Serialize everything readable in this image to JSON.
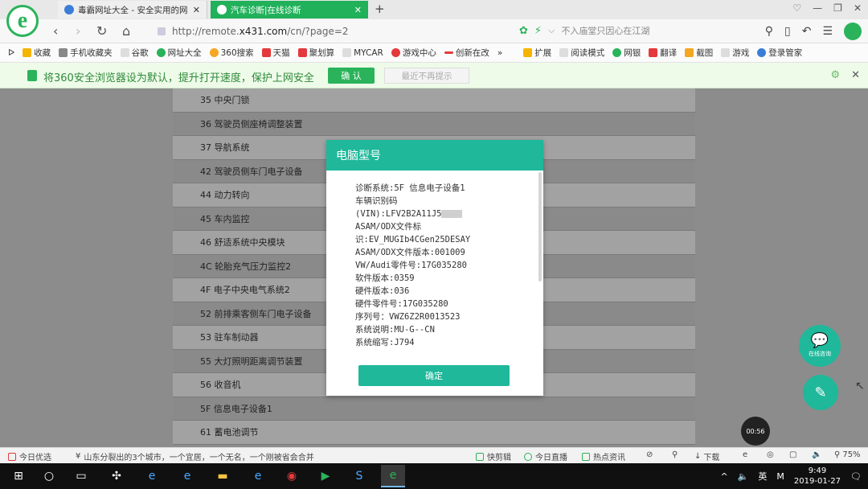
{
  "browser": {
    "tabs": [
      {
        "label": "毒霸网址大全 - 安全实用的网址"
      },
      {
        "label": "汽车诊断|在线诊断"
      }
    ],
    "url_prefix": "http://remote.",
    "url_host": "x431.com",
    "url_path": "/cn/?page=2",
    "search_hint": "不入庙堂只因心在江湖",
    "bookmarks": [
      "收藏",
      "手机收藏夹",
      "谷歌",
      "网址大全",
      "360搜索",
      "天猫",
      "聚划算",
      "MYCAR",
      "游戏中心",
      "创新在改",
      "扩展",
      "阅读模式",
      "网银",
      "翻译",
      "截图",
      "游戏",
      "登录管家"
    ]
  },
  "notification": {
    "message": "将360安全浏览器设为默认，提升打开速度，保护上网安全",
    "confirm": "确 认",
    "dismiss": "最近不再提示"
  },
  "list": [
    "35 中央门锁",
    "36 驾驶员侧座椅调整装置",
    "37 导航系统",
    "42 驾驶员侧车门电子设备",
    "44 动力转向",
    "45 车内监控",
    "46 舒适系统中央模块",
    "4C 轮胎充气压力监控2",
    "4F 电子中央电气系统2",
    "52 前排乘客侧车门电子设备",
    "53 驻车制动器",
    "55 大灯照明距离调节装置",
    "56 收音机",
    "5F 信息电子设备1",
    "61 蓄电池调节"
  ],
  "modal": {
    "title": "电脑型号",
    "lines": [
      "诊断系统:5F 信息电子设备1",
      "车辆识别码",
      "(VIN):LFV2B2A11J5",
      "ASAM/ODX文件标",
      "识:EV_MUGIb4CGen25DESAY",
      "ASAM/ODX文件版本:001009",
      "VW/Audi零件号:17G035280",
      "软件版本:0359",
      "硬件版本:036",
      "硬件零件号:17G035280",
      "序列号：VWZ6Z2R0013523",
      "系统说明:MU-G--CN",
      "系统缩写:J794"
    ],
    "ok": "确定"
  },
  "fab": {
    "chat_label": "在线咨询"
  },
  "timer": "00:56",
  "statusbar": {
    "left": "今日优选",
    "news": "山东分裂出的3个城市，一个宜居，一个无名，一个刚被省会合并",
    "items": [
      "快剪辑",
      "今日直播",
      "热点资讯",
      "下载"
    ],
    "zoom": "75%"
  },
  "taskbar": {
    "ime": "英",
    "time": "9:49",
    "date": "2019-01-27"
  }
}
